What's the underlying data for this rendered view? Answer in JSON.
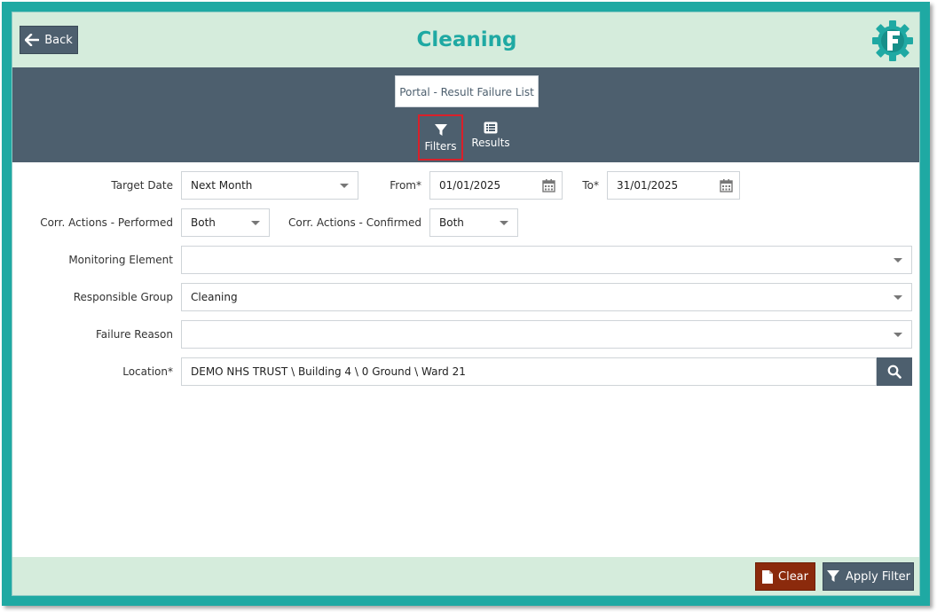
{
  "header": {
    "title": "Cleaning",
    "back_label": "Back"
  },
  "toolbar": {
    "portal_title": "Portal - Result Failure List",
    "tabs": [
      {
        "label": "Filters",
        "active": true
      },
      {
        "label": "Results",
        "active": false
      }
    ]
  },
  "filters": {
    "target_date": {
      "label": "Target Date",
      "value": "Next Month"
    },
    "from": {
      "label": "From*",
      "value": "01/01/2025"
    },
    "to": {
      "label": "To*",
      "value": "31/01/2025"
    },
    "corr_performed": {
      "label": "Corr. Actions - Performed",
      "value": "Both"
    },
    "corr_confirmed": {
      "label": "Corr. Actions - Confirmed",
      "value": "Both"
    },
    "monitoring_element": {
      "label": "Monitoring Element",
      "value": ""
    },
    "responsible_group": {
      "label": "Responsible Group",
      "value": "Cleaning"
    },
    "failure_reason": {
      "label": "Failure Reason",
      "value": ""
    },
    "location": {
      "label": "Location*",
      "value": "DEMO NHS TRUST \\ Building 4 \\ 0 Ground \\ Ward 21"
    }
  },
  "footer": {
    "clear_label": "Clear",
    "apply_label": "Apply Filter"
  },
  "colors": {
    "teal": "#1fa9a3",
    "slate": "#4d5f6e",
    "mint": "#d5ecdc",
    "clear_red": "#8b2a0c",
    "active_tab_border": "#d9202a"
  }
}
